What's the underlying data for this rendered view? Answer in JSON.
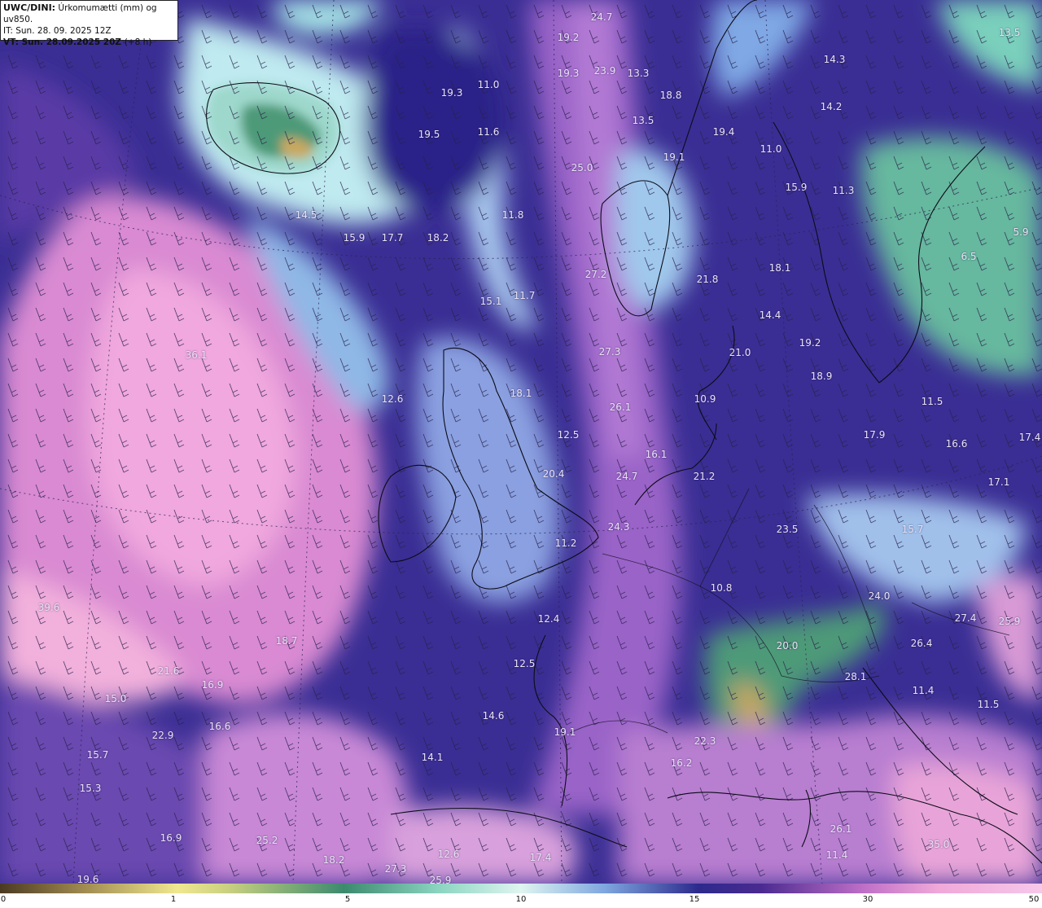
{
  "header": {
    "title": "UWC/DINI:",
    "description": "Úrkomumætti (mm) og uv850.",
    "initial_time": "IT: Sun. 28. 09. 2025 12Z",
    "valid_time": "VT: Sun. 28.09.2025 20Z",
    "forecast_step": "(+8 h)"
  },
  "colorbar": {
    "ticks": [
      "0",
      "1",
      "5",
      "10",
      "15",
      "30",
      "50"
    ]
  },
  "value_labels": [
    "24.7",
    "19.2",
    "19.3",
    "23.9",
    "13.3",
    "19.3",
    "11.0",
    "18.8",
    "13.5",
    "19.5",
    "11.6",
    "19.4",
    "19.1",
    "25.0",
    "14.5",
    "15.9",
    "17.7",
    "18.2",
    "11.8",
    "27.2",
    "21.8",
    "18.1",
    "14.4",
    "11.7",
    "15.1",
    "21.0",
    "19.2",
    "36.1",
    "27.3",
    "18.1",
    "18.9",
    "12.6",
    "26.1",
    "10.9",
    "12.5",
    "16.1",
    "20.4",
    "24.7",
    "21.2",
    "24.3",
    "23.5",
    "11.2",
    "10.8",
    "12.4",
    "24.0",
    "27.4",
    "25.9",
    "39.6",
    "18.7",
    "20.0",
    "26.4",
    "21.6",
    "16.9",
    "15.0",
    "12.5",
    "28.1",
    "11.4",
    "11.5",
    "16.6",
    "14.6",
    "19.1",
    "22.9",
    "22.3",
    "16.2",
    "15.7",
    "14.1",
    "15.3",
    "16.9",
    "25.2",
    "18.2",
    "12.6",
    "17.4",
    "27.3",
    "25.9",
    "19.6",
    "26.1",
    "11.4",
    "35.0",
    "13.5",
    "14.3",
    "14.2",
    "11.0",
    "15.9",
    "11.3",
    "5.9",
    "6.5",
    "11.5",
    "17.9",
    "16.6",
    "17.4",
    "17.1",
    "15.7"
  ],
  "colors": {
    "deep_blue": "#2b2590",
    "purple": "#6a3ea8",
    "pink": "#e89ad8",
    "light_cyan": "#bff0f0",
    "green": "#4e9a78",
    "sand": "#c8a860"
  }
}
